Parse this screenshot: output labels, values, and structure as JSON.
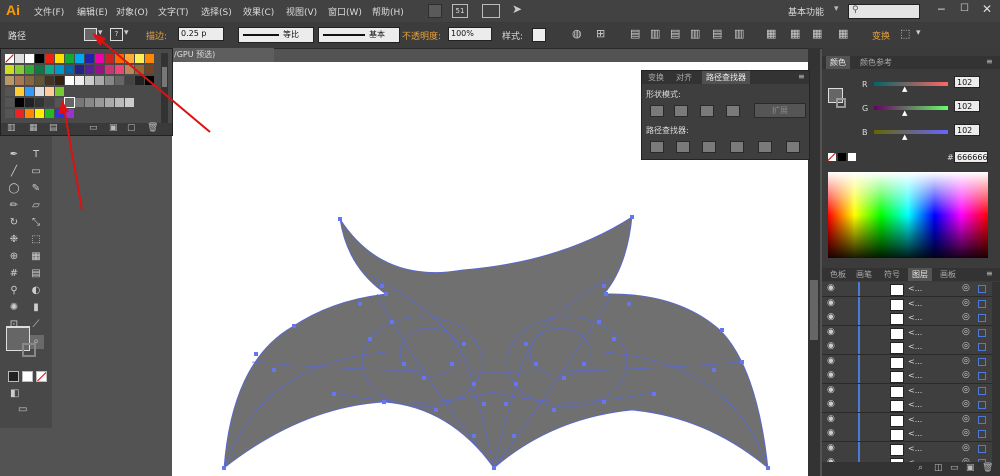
{
  "app": {
    "logo": "Ai"
  },
  "menu": [
    "文件(F)",
    "编辑(E)",
    "对象(O)",
    "文字(T)",
    "选择(S)",
    "效果(C)",
    "视图(V)",
    "窗口(W)",
    "帮助(H)"
  ],
  "menubar_right": {
    "mode_box": "51",
    "workspace": "基本功能",
    "search_icon": "search-icon"
  },
  "control_bar": {
    "object_type": "路径",
    "stroke_label": "描边:",
    "stroke_value": "0.25 p",
    "profile_label": "等比",
    "brush_label": "基本",
    "opacity_label": "不透明度:",
    "opacity_value": "100%",
    "style_label": "样式:",
    "transform_label": "变换"
  },
  "doc_tab": {
    "label": "/GPU 预选)"
  },
  "pathfinder": {
    "tabs": [
      "变换",
      "对齐",
      "路径查找器"
    ],
    "active_tab": 2,
    "shape_modes_label": "形状模式:",
    "expand_label": "扩展",
    "pathfinders_label": "路径查找器:"
  },
  "color_panel": {
    "tabs": [
      "颜色",
      "颜色参考"
    ],
    "r_label": "R",
    "g_label": "G",
    "b_label": "B",
    "r": "102",
    "g": "102",
    "b": "102",
    "hash_label": "#",
    "hex": "666666",
    "fill_color": "#666666"
  },
  "layers_panel": {
    "tabs": [
      "色板",
      "画笔",
      "符号",
      "图层",
      "画板"
    ],
    "active_tab": 3,
    "row_label": "<...",
    "row_count": 13
  },
  "colors": {
    "shape_fill": "#707070",
    "path_stroke": "#5566dd",
    "anchor": "#6677ee",
    "arrow": "#dd1111"
  }
}
